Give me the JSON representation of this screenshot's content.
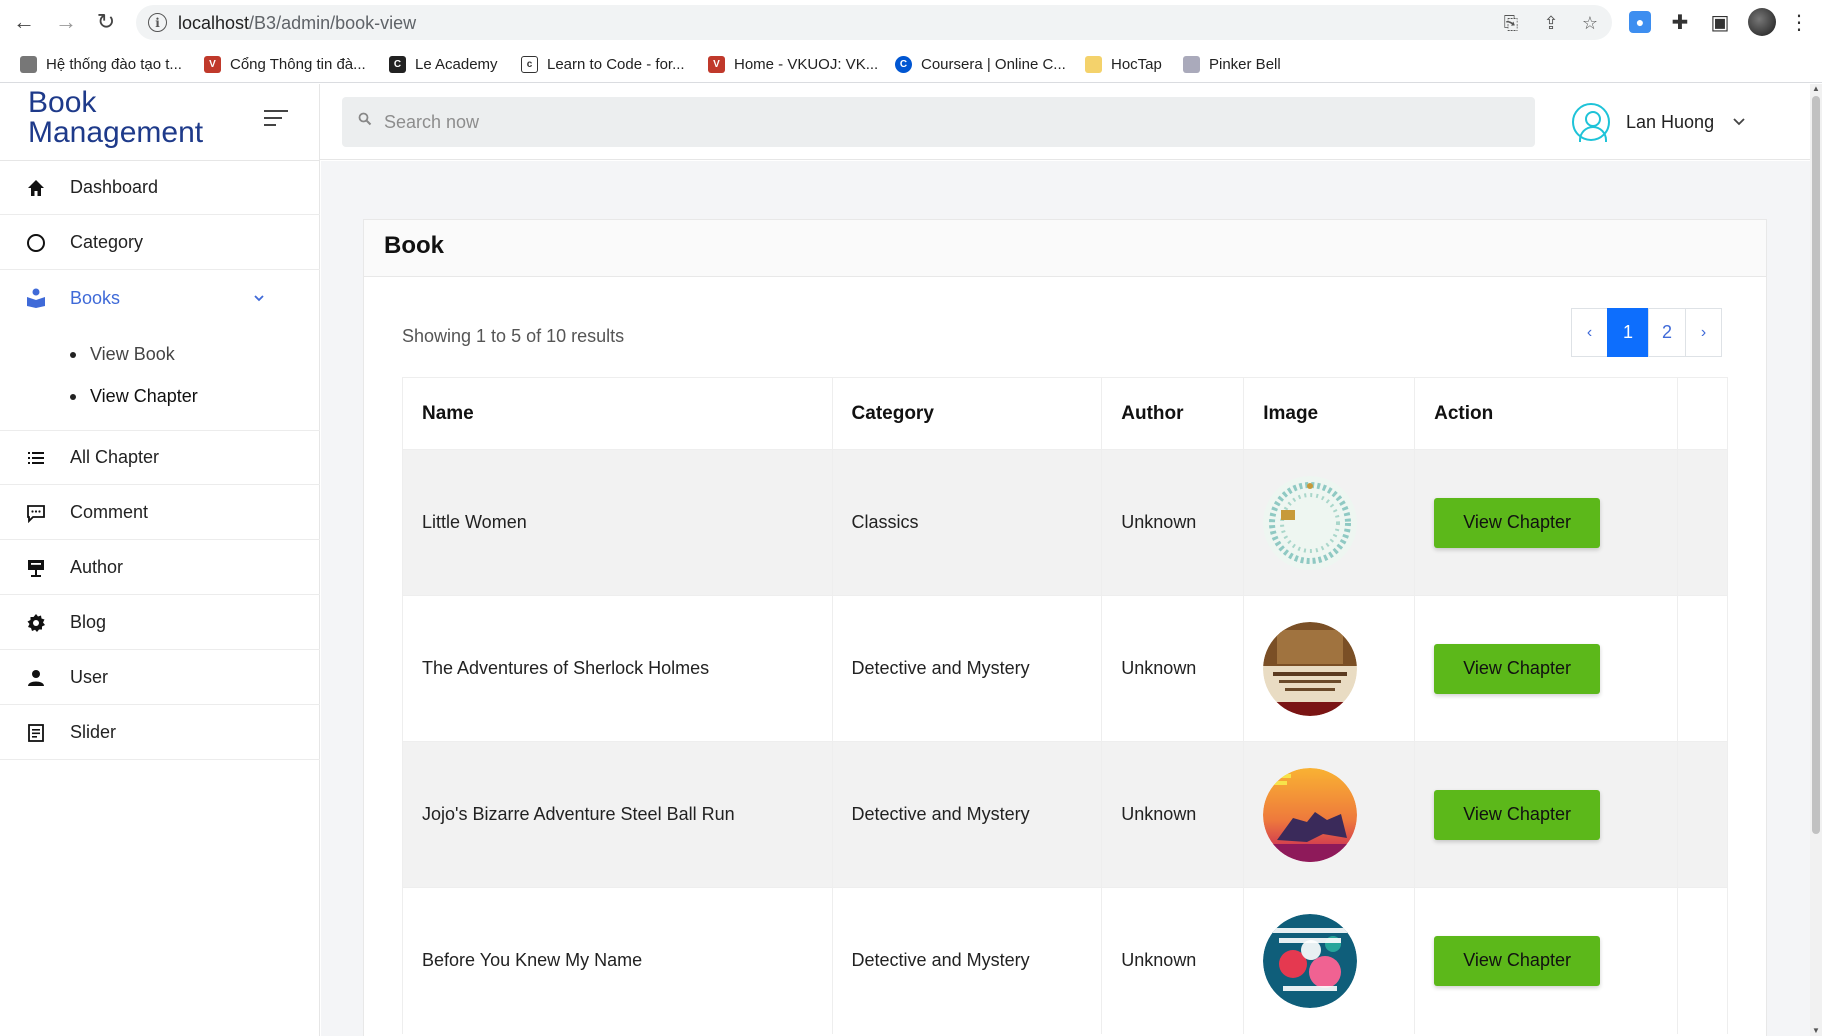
{
  "browser": {
    "url_host": "localhost",
    "url_path": "/B3/admin/book-view"
  },
  "bookmarks": [
    {
      "label": "Hệ thống đào tạo t...",
      "icon": "document-icon",
      "color": "#666666"
    },
    {
      "label": "Cổng Thông tin đà...",
      "icon": "vku-icon",
      "color": "#c0392b"
    },
    {
      "label": "Le Academy",
      "icon": "c-letter-icon",
      "color": "#222222"
    },
    {
      "label": "Learn to Code - for...",
      "icon": "freecodecamp-icon",
      "color": "#333333"
    },
    {
      "label": "Home - VKUOJ: VK...",
      "icon": "vku-icon",
      "color": "#c0392b"
    },
    {
      "label": "Coursera | Online C...",
      "icon": "coursera-icon",
      "color": "#0056d2"
    },
    {
      "label": "HocTap",
      "icon": "folder-icon",
      "color": "#f4c542"
    },
    {
      "label": "Pinker Bell",
      "icon": "image-icon",
      "color": "#888888"
    }
  ],
  "sidebar": {
    "brand_line1": "Book",
    "brand_line2": "Management",
    "items": [
      {
        "label": "Dashboard",
        "icon": "home-icon"
      },
      {
        "label": "Category",
        "icon": "circle-icon"
      },
      {
        "label": "Books",
        "icon": "book-reader-icon",
        "active": true
      },
      {
        "label": "All Chapter",
        "icon": "list-icon"
      },
      {
        "label": "Comment",
        "icon": "comment-icon"
      },
      {
        "label": "Author",
        "icon": "presenter-icon"
      },
      {
        "label": "Blog",
        "icon": "gear-icon"
      },
      {
        "label": "User",
        "icon": "user-icon"
      },
      {
        "label": "Slider",
        "icon": "document-lines-icon"
      }
    ],
    "sub_items": [
      {
        "label": "View Book"
      },
      {
        "label": "View Chapter"
      }
    ]
  },
  "topbar": {
    "search_placeholder": "Search now",
    "user_name": "Lan Huong"
  },
  "card": {
    "title": "Book",
    "showing": "Showing 1 to 5 of 10 results"
  },
  "pagination": {
    "prev": "‹",
    "pages": [
      "1",
      "2"
    ],
    "active_page": "1",
    "next": "›"
  },
  "table": {
    "headers": [
      "Name",
      "Category",
      "Author",
      "Image",
      "Action"
    ],
    "rows": [
      {
        "name": "Little Women",
        "category": "Classics",
        "author": "Unknown",
        "action": "View Chapter",
        "cover_colors": [
          "#e9f3ee",
          "#8fc9c3"
        ]
      },
      {
        "name": "The Adventures of Sherlock Holmes",
        "category": "Detective and Mystery",
        "author": "Unknown",
        "action": "View Chapter",
        "cover_colors": [
          "#8a5a2b",
          "#e8dcc4"
        ]
      },
      {
        "name": "Jojo's Bizarre Adventure Steel Ball Run",
        "category": "Detective and Mystery",
        "author": "Unknown",
        "action": "View Chapter",
        "cover_colors": [
          "#f6a623",
          "#c2185b"
        ]
      },
      {
        "name": "Before You Knew My Name",
        "category": "Detective and Mystery",
        "author": "Unknown",
        "action": "View Chapter",
        "cover_colors": [
          "#0f5e7a",
          "#e53950"
        ]
      }
    ]
  },
  "colors": {
    "brand": "#1e3a8a",
    "active_menu": "#3f6ad8",
    "pager_active": "#0d6efd",
    "action_button": "#5cb81a"
  }
}
